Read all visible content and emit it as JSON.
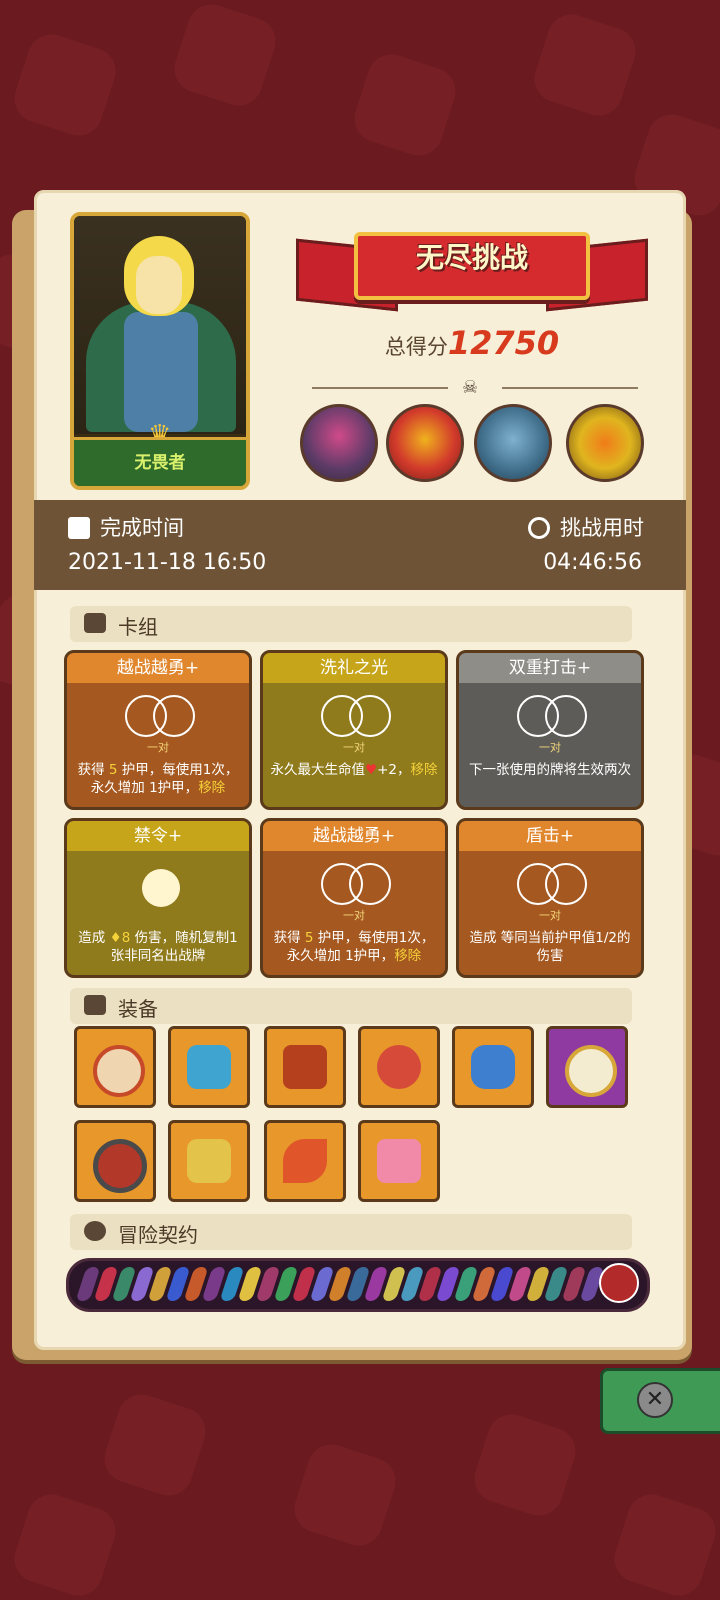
{
  "mode_title": "无尽挑战",
  "character": {
    "name": "无畏者"
  },
  "score": {
    "label": "总得分",
    "value": "12750"
  },
  "time_info": {
    "completion_label": "完成时间",
    "completion_value": "2021-11-18 16:50",
    "duration_label": "挑战用时",
    "duration_value": "04:46:56"
  },
  "sections": {
    "deck": "卡组",
    "equipment": "装备",
    "contract": "冒险契约"
  },
  "cards": [
    {
      "title": "越战越勇+",
      "sub": "一对",
      "desc_a": "获得 ",
      "num": "5",
      "desc_b": " 护甲，每使用1次，永久增加 ",
      "desc_c": "1护甲，",
      "desc_d": "移除"
    },
    {
      "title": "洗礼之光",
      "sub": "一对",
      "desc_a": "永久最大生命值",
      "num": "+2，",
      "desc_b": "",
      "desc_c": "",
      "desc_d": "移除"
    },
    {
      "title": "双重打击+",
      "sub": "一对",
      "desc_a": "下一张使用的牌将生效两次",
      "num": "",
      "desc_b": "",
      "desc_c": "",
      "desc_d": ""
    },
    {
      "title": "禁令+",
      "sub": "",
      "desc_a": "造成 ",
      "num": "8",
      "desc_b": " 伤害，随机复制1张非同名出战牌",
      "desc_c": "",
      "desc_d": ""
    },
    {
      "title": "越战越勇+",
      "sub": "一对",
      "desc_a": "获得 ",
      "num": "5",
      "desc_b": " 护甲，每使用1次，永久增加 ",
      "desc_c": "1护甲，",
      "desc_d": "移除"
    },
    {
      "title": "盾击+",
      "sub": "一对",
      "desc_a": "造成 等同当前",
      "num": "",
      "desc_b": "护甲值1/2的伤害",
      "desc_c": "",
      "desc_d": ""
    }
  ],
  "colors": {
    "accent_red": "#d83a1e",
    "header_brown": "#6e5336",
    "page": "#f7efd8"
  }
}
